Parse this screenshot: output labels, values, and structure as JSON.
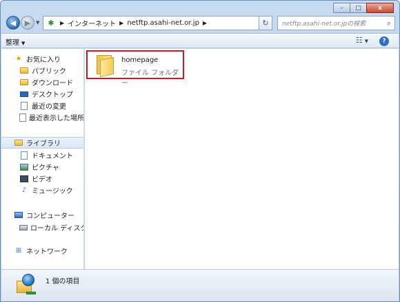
{
  "window": {
    "caption": {
      "minimize": "–",
      "maximize": "□",
      "close": "x"
    }
  },
  "navigation": {
    "back_glyph": "◀",
    "forward_glyph": "▶",
    "address": {
      "icon": "internet-globe-icon",
      "segments": [
        "インターネット",
        "netftp.asahi-net.or.jp"
      ]
    },
    "search": {
      "placeholder": "netftp.asahi-net.or.jpの検索"
    }
  },
  "toolbar": {
    "organize_label": "整理",
    "view_icon": "view-options-icon",
    "help_label": "?"
  },
  "sidebar": {
    "favorites": {
      "label": "お気に入り",
      "items": [
        {
          "label": "パブリック",
          "icon": "folder-icon"
        },
        {
          "label": "ダウンロード",
          "icon": "download-folder-icon"
        },
        {
          "label": "デスクトップ",
          "icon": "desktop-icon"
        },
        {
          "label": "最近の変更",
          "icon": "recent-changes-icon"
        },
        {
          "label": "最近表示した場所",
          "icon": "recent-places-icon"
        }
      ]
    },
    "libraries": {
      "label": "ライブラリ",
      "items": [
        {
          "label": "ドキュメント",
          "icon": "documents-icon"
        },
        {
          "label": "ピクチャ",
          "icon": "pictures-icon"
        },
        {
          "label": "ビデオ",
          "icon": "videos-icon"
        },
        {
          "label": "ミュージック",
          "icon": "music-icon"
        }
      ]
    },
    "computer": {
      "label": "コンピューター",
      "items": [
        {
          "label": "ローカル ディスク (",
          "icon": "local-disk-icon"
        }
      ]
    },
    "network": {
      "label": "ネットワーク"
    }
  },
  "content": {
    "items": [
      {
        "name": "homepage",
        "type": "ファイル フォルダー",
        "icon": "folder-icon"
      }
    ]
  },
  "details": {
    "icon": "network-location-icon",
    "count_text": "1 個の項目"
  },
  "colors": {
    "highlight_box": "#d3141a",
    "frame": "#b7cde8"
  }
}
